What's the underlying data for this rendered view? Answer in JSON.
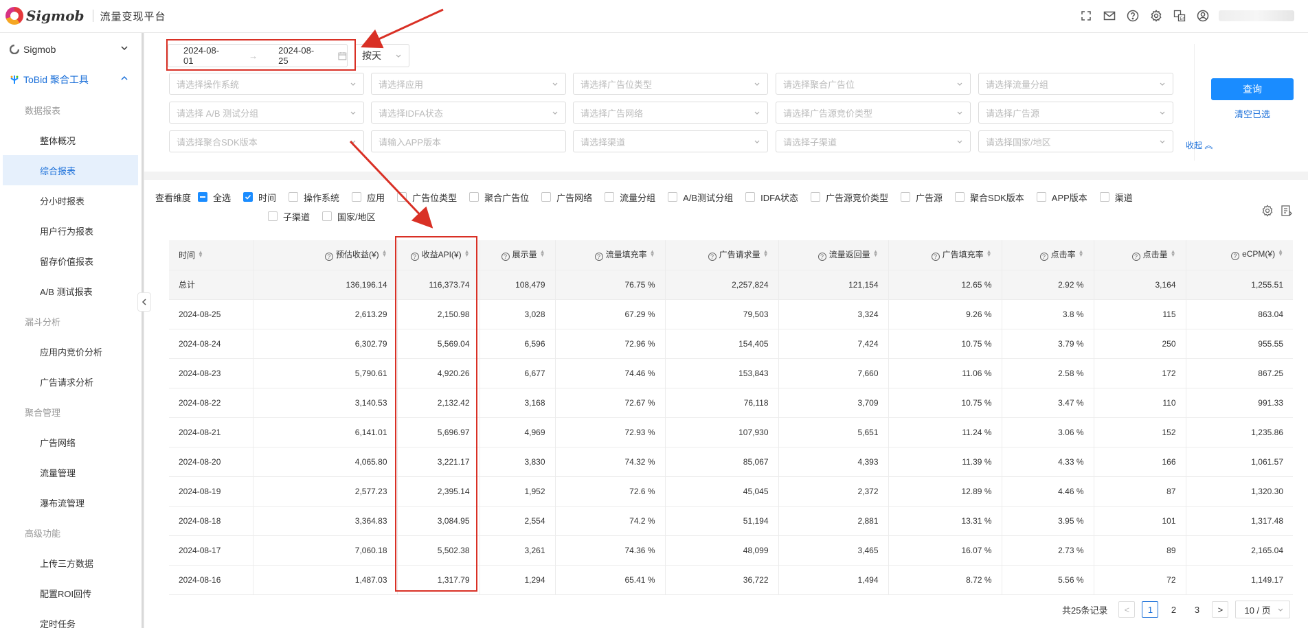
{
  "header": {
    "logo": "Sigmob",
    "platform": "流量变现平台",
    "icons": [
      "fullscreen-icon",
      "mail-icon",
      "help-icon",
      "gear-icon",
      "language-icon",
      "user-icon"
    ]
  },
  "sidebar": {
    "groups": [
      {
        "label": "Sigmob"
      },
      {
        "label": "ToBid 聚合工具"
      }
    ],
    "sections": {
      "s1": "数据报表",
      "s2": "漏斗分析",
      "s3": "聚合管理",
      "s4": "高级功能"
    },
    "items": {
      "i1": "整体概况",
      "i2": "综合报表",
      "i3": "分小时报表",
      "i4": "用户行为报表",
      "i5": "留存价值报表",
      "i6": "A/B 测试报表",
      "i7": "应用内竞价分析",
      "i8": "广告请求分析",
      "i9": "广告网络",
      "i10": "流量管理",
      "i11": "瀑布流管理",
      "i12": "上传三方数据",
      "i13": "配置ROI回传",
      "i14": "定时任务"
    }
  },
  "filters": {
    "start_date": "2024-08-01",
    "end_date": "2024-08-25",
    "granularity": "按天",
    "placeholders": {
      "p1": "请选择操作系统",
      "p2": "请选择应用",
      "p3": "请选择广告位类型",
      "p4": "请选择聚合广告位",
      "p5": "请选择流量分组",
      "p6": "请选择 A/B 测试分组",
      "p7": "请选择IDFA状态",
      "p8": "请选择广告网络",
      "p9": "请选择广告源竞价类型",
      "p10": "请选择广告源",
      "p11": "请选择聚合SDK版本",
      "p12": "请输入APP版本",
      "p13": "请选择渠道",
      "p14": "请选择子渠道",
      "p15": "请选择国家/地区"
    },
    "query_label": "查询",
    "clear_label": "清空已选",
    "fold_label": "收起"
  },
  "dimensions": {
    "title": "查看维度",
    "all": "全选",
    "options": {
      "o1": "时间",
      "o2": "操作系统",
      "o3": "应用",
      "o4": "广告位类型",
      "o5": "聚合广告位",
      "o6": "广告网络",
      "o7": "流量分组",
      "o8": "A/B测试分组",
      "o9": "IDFA状态",
      "o10": "广告源竞价类型",
      "o11": "广告源",
      "o12": "聚合SDK版本",
      "o13": "APP版本",
      "o14": "渠道",
      "o15": "子渠道",
      "o16": "国家/地区"
    }
  },
  "table": {
    "columns": [
      "时间",
      "预估收益(¥)",
      "收益API(¥)",
      "展示量",
      "流量填充率",
      "广告请求量",
      "流量返回量",
      "广告填充率",
      "点击率",
      "点击量",
      "eCPM(¥)"
    ],
    "rows": [
      [
        "总计",
        "136,196.14",
        "116,373.74",
        "108,479",
        "76.75 %",
        "2,257,824",
        "121,154",
        "12.65 %",
        "2.92 %",
        "3,164",
        "1,255.51"
      ],
      [
        "2024-08-25",
        "2,613.29",
        "2,150.98",
        "3,028",
        "67.29 %",
        "79,503",
        "3,324",
        "9.26 %",
        "3.8 %",
        "115",
        "863.04"
      ],
      [
        "2024-08-24",
        "6,302.79",
        "5,569.04",
        "6,596",
        "72.96 %",
        "154,405",
        "7,424",
        "10.75 %",
        "3.79 %",
        "250",
        "955.55"
      ],
      [
        "2024-08-23",
        "5,790.61",
        "4,920.26",
        "6,677",
        "74.46 %",
        "153,843",
        "7,660",
        "11.06 %",
        "2.58 %",
        "172",
        "867.25"
      ],
      [
        "2024-08-22",
        "3,140.53",
        "2,132.42",
        "3,168",
        "72.67 %",
        "76,118",
        "3,709",
        "10.75 %",
        "3.47 %",
        "110",
        "991.33"
      ],
      [
        "2024-08-21",
        "6,141.01",
        "5,696.97",
        "4,969",
        "72.93 %",
        "107,930",
        "5,651",
        "11.24 %",
        "3.06 %",
        "152",
        "1,235.86"
      ],
      [
        "2024-08-20",
        "4,065.80",
        "3,221.17",
        "3,830",
        "74.32 %",
        "85,067",
        "4,393",
        "11.39 %",
        "4.33 %",
        "166",
        "1,061.57"
      ],
      [
        "2024-08-19",
        "2,577.23",
        "2,395.14",
        "1,952",
        "72.6 %",
        "45,045",
        "2,372",
        "12.89 %",
        "4.46 %",
        "87",
        "1,320.30"
      ],
      [
        "2024-08-18",
        "3,364.83",
        "3,084.95",
        "2,554",
        "74.2 %",
        "51,194",
        "2,881",
        "13.31 %",
        "3.95 %",
        "101",
        "1,317.48"
      ],
      [
        "2024-08-17",
        "7,060.18",
        "5,502.38",
        "3,261",
        "74.36 %",
        "48,099",
        "3,465",
        "16.07 %",
        "2.73 %",
        "89",
        "2,165.04"
      ],
      [
        "2024-08-16",
        "1,487.03",
        "1,317.79",
        "1,294",
        "65.41 %",
        "36,722",
        "1,494",
        "8.72 %",
        "5.56 %",
        "72",
        "1,149.17"
      ]
    ]
  },
  "pagination": {
    "total": "共25条记录",
    "pages": [
      "1",
      "2",
      "3"
    ],
    "page_size": "10 / 页"
  },
  "colors": {
    "accent": "#1a8cff",
    "link": "#1a6fd9",
    "annotation": "#d93025"
  }
}
